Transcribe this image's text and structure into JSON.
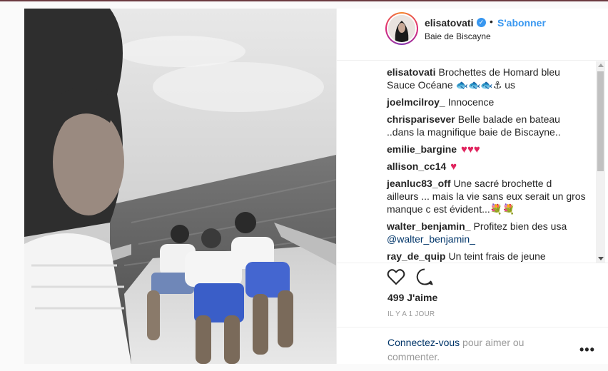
{
  "post": {
    "username": "elisatovati",
    "follow_label": "S'abonner",
    "separator": "•",
    "location": "Baie de Biscayne",
    "verified_mark": "✓"
  },
  "comments": [
    {
      "user": "elisatovati",
      "line1": "Brochettes de Homard bleu",
      "line2": "Sauce Océane 🐟🐟🐟⚓ us"
    },
    {
      "user": "joelmcilroy_",
      "text": "Innocence"
    },
    {
      "user": "chrisparisever",
      "line1": "Belle balade en bateau",
      "line2": "..dans la magnifique baie de Biscayne.."
    },
    {
      "user": "emilie_bargine",
      "text": "♥♥♥"
    },
    {
      "user": "allison_cc14",
      "text": "♥"
    },
    {
      "user": "jeanluc83_off",
      "line1": "Une sacré brochette d",
      "line2": "ailleurs ... mais la vie sans eux serait un gros",
      "line3": "manque c est évident...💐💐"
    },
    {
      "user": "walter_benjamin_",
      "line1": "Profitez bien des usa",
      "mention": "@walter_benjamin_"
    },
    {
      "user": "ray_de_quip",
      "text": "Un teint frais de jeune"
    }
  ],
  "actions": {
    "like_icon": "heart-outline",
    "comment_icon": "speech-bubble-outline",
    "likes": "499 J'aime",
    "timestamp": "IL Y A 1 JOUR"
  },
  "footer": {
    "login_link": "Connectez-vous",
    "login_rest": " pour aimer ou commenter.",
    "more": "•••"
  },
  "colors": {
    "link_blue": "#3897f0",
    "text": "#262626",
    "muted": "#999999",
    "mention": "#003569",
    "heart_red": "#e0245e"
  }
}
